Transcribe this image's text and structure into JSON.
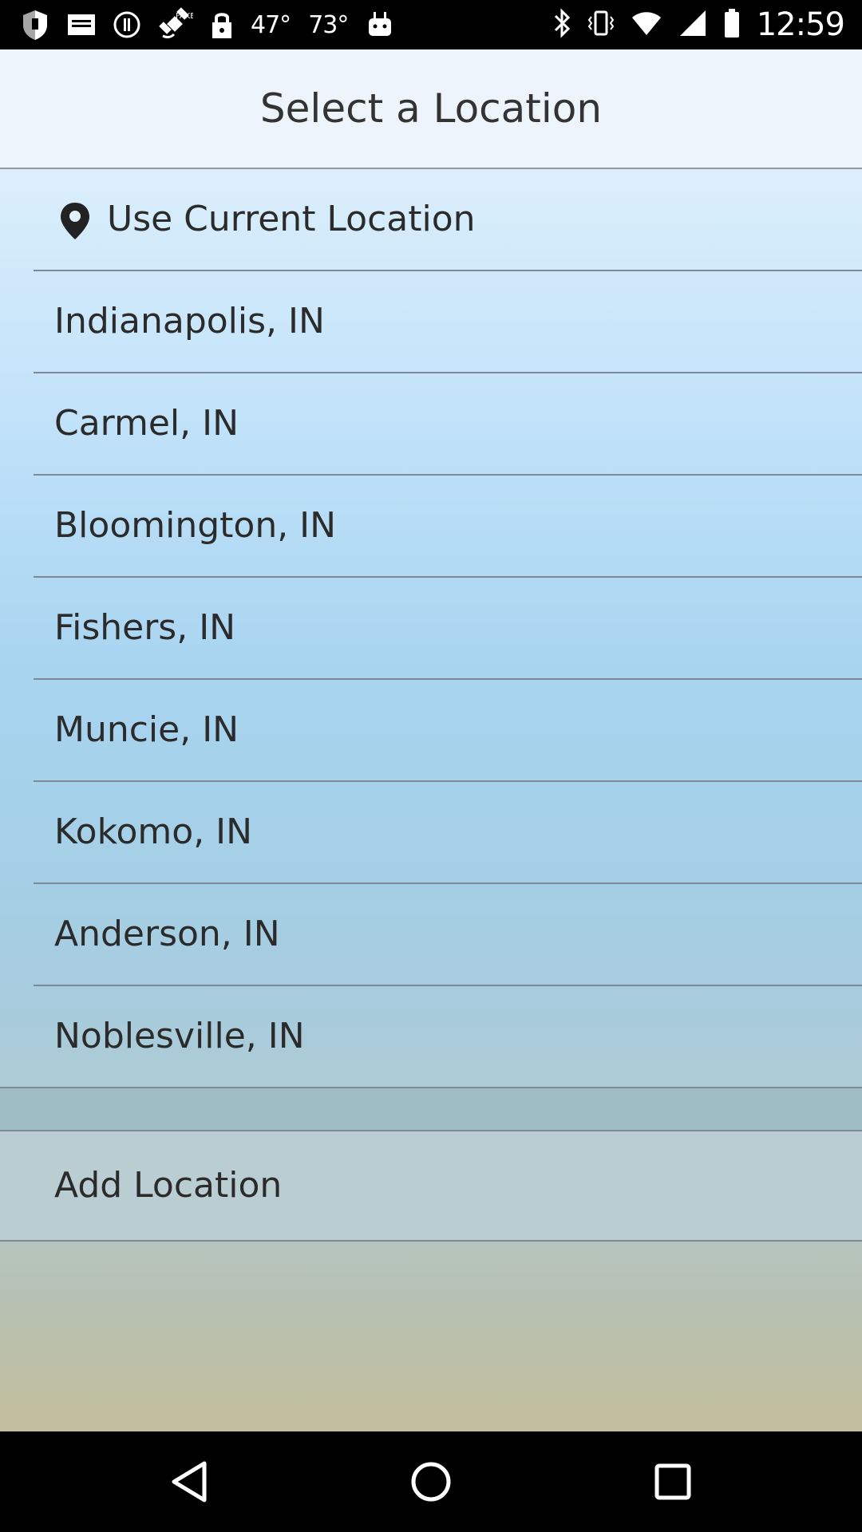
{
  "status_bar": {
    "temperature_1": "47°",
    "temperature_2": "73°",
    "time": "12:59",
    "left_icons": [
      "shield-icon",
      "mail-icon",
      "alert-icon",
      "satellite-icon",
      "lock-icon",
      "android-icon"
    ],
    "right_icons": [
      "bluetooth-icon",
      "vibrate-icon",
      "wifi-icon",
      "signal-icon",
      "battery-icon"
    ]
  },
  "header": {
    "title": "Select a Location"
  },
  "current_location": {
    "label": "Use Current Location",
    "icon": "location-pin-icon"
  },
  "locations": [
    {
      "label": "Indianapolis, IN"
    },
    {
      "label": "Carmel, IN"
    },
    {
      "label": "Bloomington, IN"
    },
    {
      "label": "Fishers, IN"
    },
    {
      "label": "Muncie, IN"
    },
    {
      "label": "Kokomo, IN"
    },
    {
      "label": "Anderson, IN"
    },
    {
      "label": "Noblesville, IN"
    }
  ],
  "add_location": {
    "label": "Add Location"
  },
  "nav_bar": {
    "buttons": [
      "back-icon",
      "home-icon",
      "recents-icon"
    ]
  },
  "colors": {
    "header_bg": "#edf4fb",
    "divider": "#7d8a93",
    "text": "#2b2b2b"
  }
}
